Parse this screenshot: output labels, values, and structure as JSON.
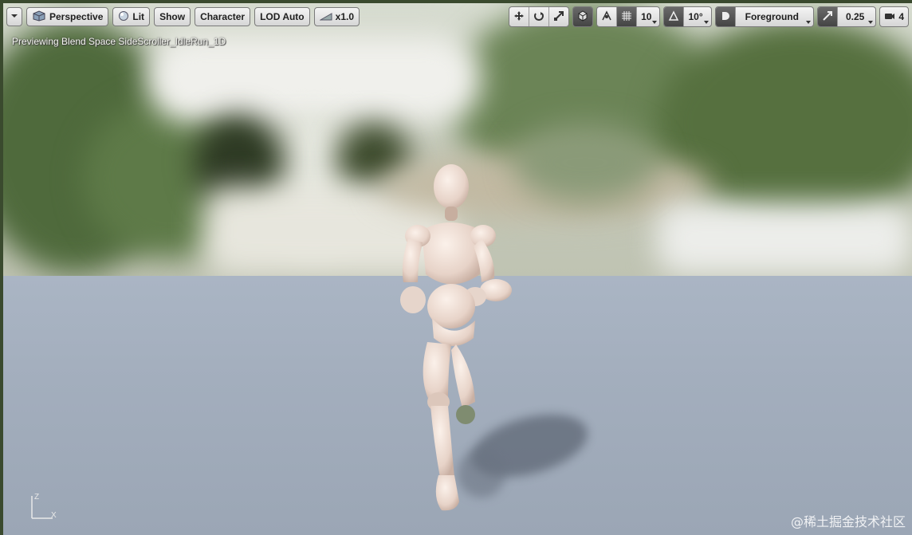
{
  "toolbar": {
    "dropdown_arrow": "chevron-down-icon",
    "perspective_label": "Perspective",
    "lit_label": "Lit",
    "show_label": "Show",
    "character_label": "Character",
    "lod_label": "LOD Auto",
    "speed_label": "x1.0",
    "grid_snap_value": "10",
    "rotation_snap_value": "10°",
    "layer_label": "Foreground",
    "scale_snap_value": "0.25",
    "camera_speed_value": "4"
  },
  "viewport": {
    "preview_text": "Previewing Blend Space SideScroller_IdleRun_1D",
    "axis_z": "Z",
    "axis_x": "X"
  },
  "watermark": "@稀土掘金技术社区",
  "colors": {
    "floor": "#a3aebd",
    "toolbar_button": "#e4e4e4",
    "mannequin": "#efe2da"
  }
}
